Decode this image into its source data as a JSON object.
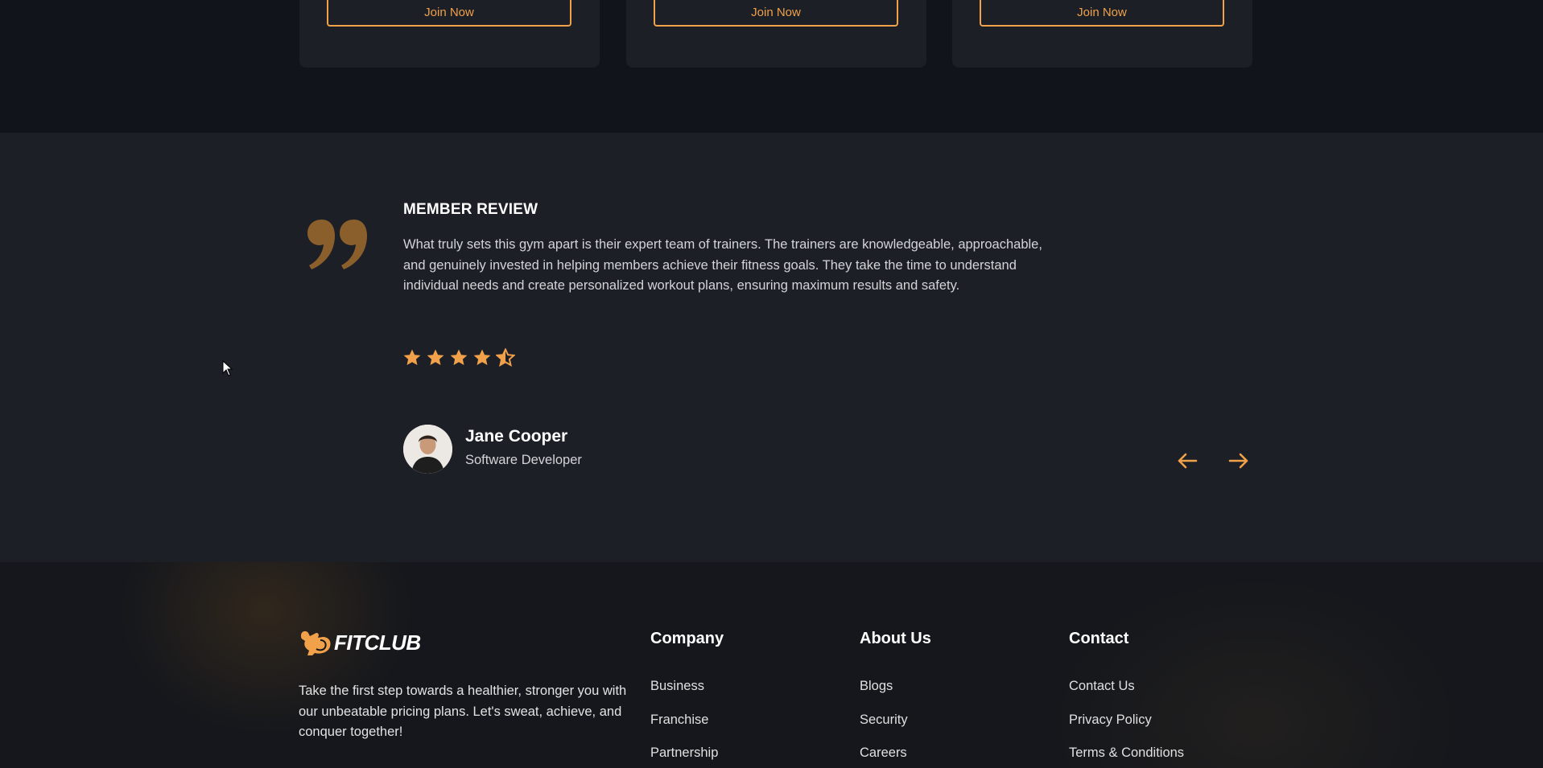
{
  "pricing": {
    "cards": [
      {
        "button_label": "Join Now"
      },
      {
        "button_label": "Join Now"
      },
      {
        "button_label": "Join Now"
      }
    ]
  },
  "review": {
    "heading": "MEMBER REVIEW",
    "text": "What truly sets this gym apart is their expert team of trainers. The trainers are knowledgeable, approachable, and genuinely invested in helping members achieve their fitness goals. They take the time to understand individual needs and create personalized workout plans, ensuring maximum results and safety.",
    "rating": 4.5,
    "rating_max": 5,
    "reviewer": {
      "name": "Jane Cooper",
      "role": "Software Developer"
    },
    "prev_icon": "arrow-left-icon",
    "next_icon": "arrow-right-icon"
  },
  "footer": {
    "brand": "FITCLUB",
    "description": "Take the first step towards a healthier, stronger you with our unbeatable pricing plans. Let's sweat, achieve, and conquer together!",
    "columns": [
      {
        "title": "Company",
        "links": [
          "Business",
          "Franchise",
          "Partnership"
        ]
      },
      {
        "title": "About Us",
        "links": [
          "Blogs",
          "Security",
          "Careers"
        ]
      },
      {
        "title": "Contact",
        "links": [
          "Contact Us",
          "Privacy Policy",
          "Terms & Conditions"
        ]
      }
    ]
  },
  "colors": {
    "accent": "#f0a14a",
    "background": "#11141b",
    "section": "#1c1f26"
  }
}
